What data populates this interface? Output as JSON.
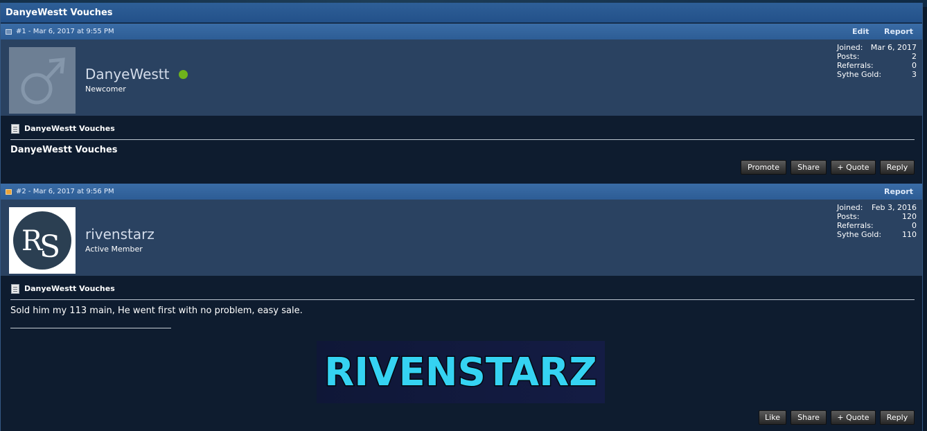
{
  "thread": {
    "title": "DanyeWestt Vouches"
  },
  "posts": [
    {
      "meta": "#1 - Mar 6, 2017 at 9:55 PM",
      "actions": [
        "Edit",
        "Report"
      ],
      "user": {
        "name": "DanyeWestt",
        "title": "Newcomer",
        "online": true,
        "avatar_icon": "male-symbol-icon"
      },
      "stats": {
        "joined_label": "Joined:",
        "joined": "Mar 6, 2017",
        "posts_label": "Posts:",
        "posts": "2",
        "referrals_label": "Referrals:",
        "referrals": "0",
        "gold_label": "Sythe Gold:",
        "gold": "3"
      },
      "post_title": "DanyeWestt Vouches",
      "body": "DanyeWestt Vouches",
      "buttons": [
        "Promote",
        "Share",
        "+ Quote",
        "Reply"
      ]
    },
    {
      "meta": "#2 - Mar 6, 2017 at 9:56 PM",
      "actions": [
        "Report"
      ],
      "user": {
        "name": "rivenstarz",
        "title": "Active Member",
        "online": false,
        "avatar_icon": "rs-logo-icon"
      },
      "stats": {
        "joined_label": "Joined:",
        "joined": "Feb 3, 2016",
        "posts_label": "Posts:",
        "posts": "120",
        "referrals_label": "Referrals:",
        "referrals": "0",
        "gold_label": "Sythe Gold:",
        "gold": "110"
      },
      "post_title": "DanyeWestt Vouches",
      "body": "Sold him my 113 main, He went first with no problem, easy sale.",
      "signature_banner": "RIVENSTARZ",
      "buttons": [
        "Like",
        "Share",
        "+ Quote",
        "Reply"
      ]
    }
  ],
  "colors": {
    "header_blue": "#2e5f97",
    "userbar": "#2a4261",
    "content_bg": "#0e1c2f",
    "online_green": "#6fb31b",
    "banner_cyan": "#35d3f2"
  }
}
